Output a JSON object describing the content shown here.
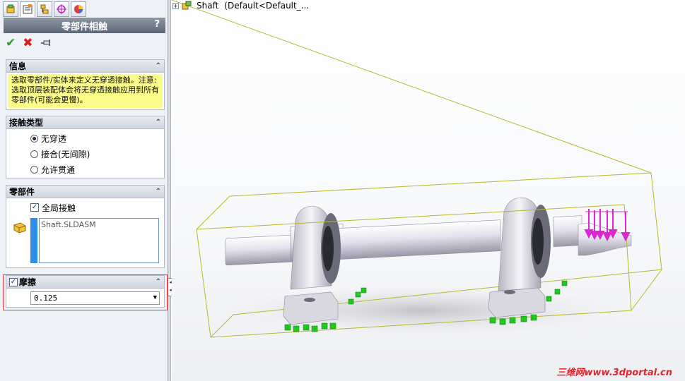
{
  "property_manager": {
    "tabs": [
      "feature-manager-icon",
      "property-manager-icon",
      "configuration-manager-icon",
      "dimxpert-icon",
      "display-manager-icon"
    ],
    "title": "零部件相触",
    "help": "?",
    "actions": {
      "ok": "✔",
      "cancel": "✖",
      "pin": "pin-icon"
    },
    "info": {
      "header": "信息",
      "text": "选取零部件/实体来定义无穿透接触。注意:选取顶层装配体会将无穿透接触应用到所有零部件(可能会更慢)。"
    },
    "contact_type": {
      "header": "接触类型",
      "options": [
        "无穿透",
        "接合(无间隙)",
        "允许贯通"
      ],
      "selected": 0
    },
    "components": {
      "header": "零部件",
      "global_contact_label": "全局接触",
      "global_contact_checked": true,
      "selected_items": [
        "Shaft.SLDASM"
      ]
    },
    "friction": {
      "header": "摩擦",
      "checked": true,
      "value": "0.125"
    }
  },
  "viewport": {
    "tree_label": "Shaft",
    "tree_config": "(Default<Default_...",
    "watermark": "三维网www.3dportal.cn",
    "colors": {
      "bbox": "#b6b82a",
      "load_arrows": "#d928d0",
      "fixtures": "#20c820",
      "highlight": "#e23a3a"
    }
  }
}
